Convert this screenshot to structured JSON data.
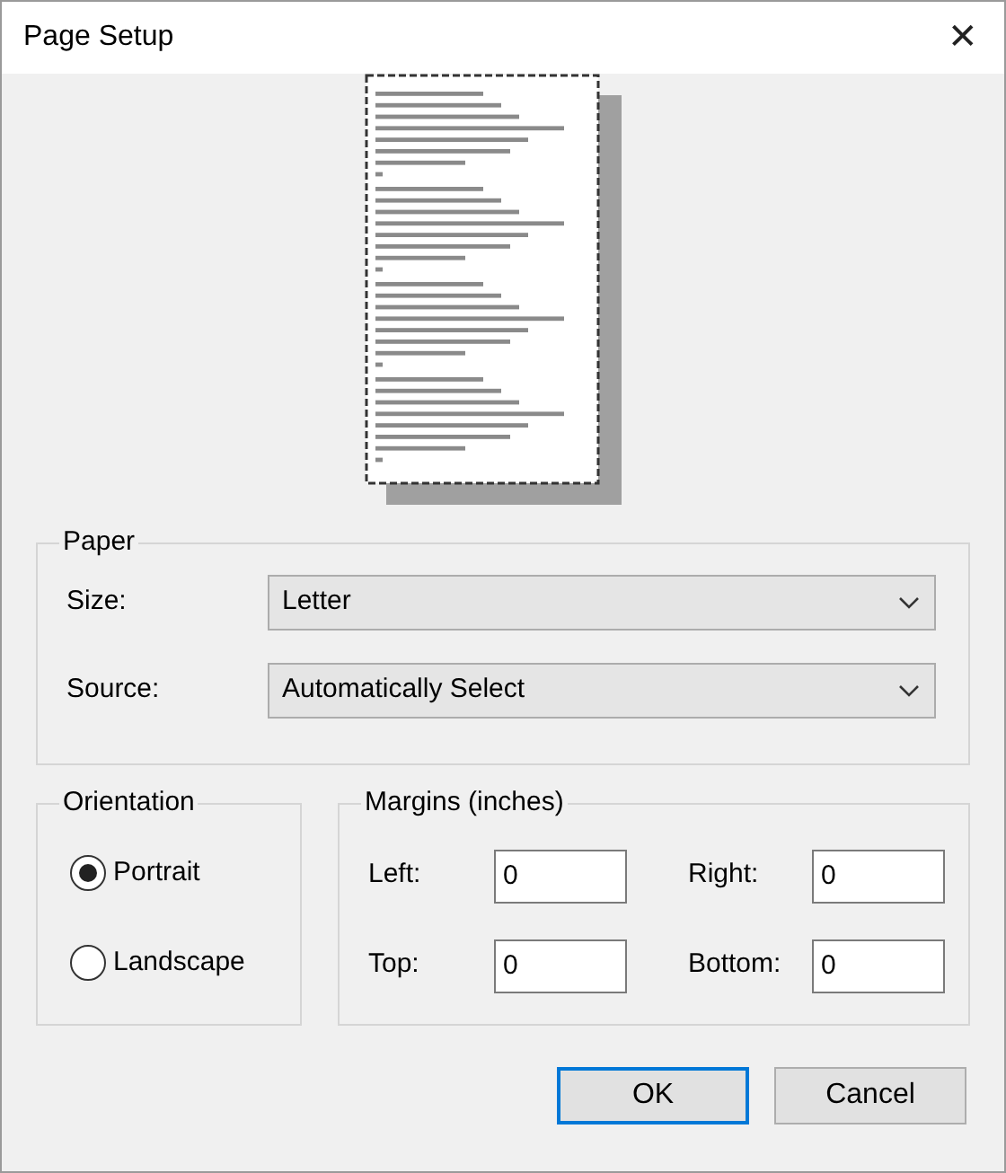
{
  "window": {
    "title": "Page Setup",
    "close": "✕"
  },
  "paper": {
    "title": "Paper",
    "fields": [
      {
        "label": "Size:",
        "value": "Letter"
      },
      {
        "label": "Source:",
        "value": "Automatically Select"
      }
    ]
  },
  "orientation": {
    "title": "Orientation",
    "options": [
      {
        "label": "Portrait",
        "selected": true
      },
      {
        "label": "Landscape",
        "selected": false
      }
    ]
  },
  "margins": {
    "title": "Margins (inches)",
    "fields": [
      {
        "label": "Left:",
        "value": "0"
      },
      {
        "label": "Right:",
        "value": "0"
      },
      {
        "label": "Top:",
        "value": "0"
      },
      {
        "label": "Bottom:",
        "value": "0"
      }
    ]
  },
  "buttons": [
    {
      "label": "OK",
      "default": true
    },
    {
      "label": "Cancel",
      "default": false
    }
  ]
}
